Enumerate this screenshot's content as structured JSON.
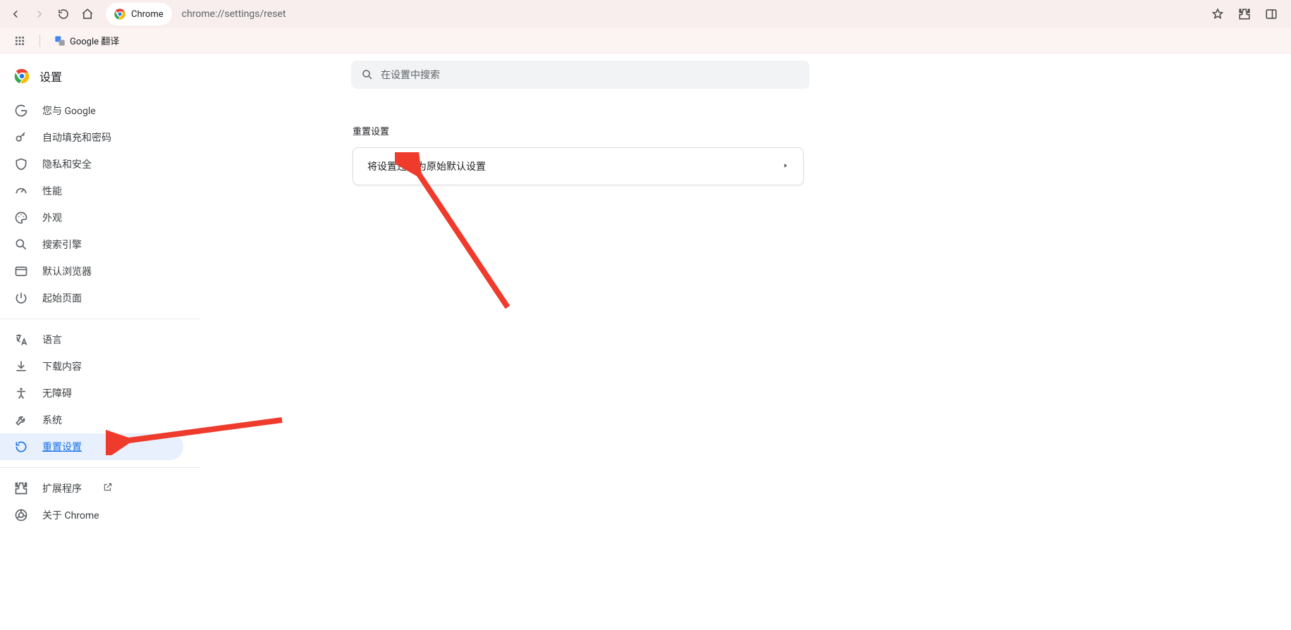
{
  "chrome": {
    "url_prefix": "Chrome",
    "url": "chrome://settings/reset"
  },
  "bookmarks": {
    "translate": "Google 翻译"
  },
  "sidebar": {
    "title": "设置",
    "items_a": [
      {
        "label": "您与 Google"
      },
      {
        "label": "自动填充和密码"
      },
      {
        "label": "隐私和安全"
      },
      {
        "label": "性能"
      },
      {
        "label": "外观"
      },
      {
        "label": "搜索引擎"
      },
      {
        "label": "默认浏览器"
      },
      {
        "label": "起始页面"
      }
    ],
    "items_b": [
      {
        "label": "语言"
      },
      {
        "label": "下载内容"
      },
      {
        "label": "无障碍"
      },
      {
        "label": "系统"
      },
      {
        "label": "重置设置"
      }
    ],
    "items_c": [
      {
        "label": "扩展程序"
      },
      {
        "label": "关于 Chrome"
      }
    ]
  },
  "search": {
    "placeholder": "在设置中搜索"
  },
  "main": {
    "section_title": "重置设置",
    "card_row": "将设置还原为原始默认设置"
  }
}
